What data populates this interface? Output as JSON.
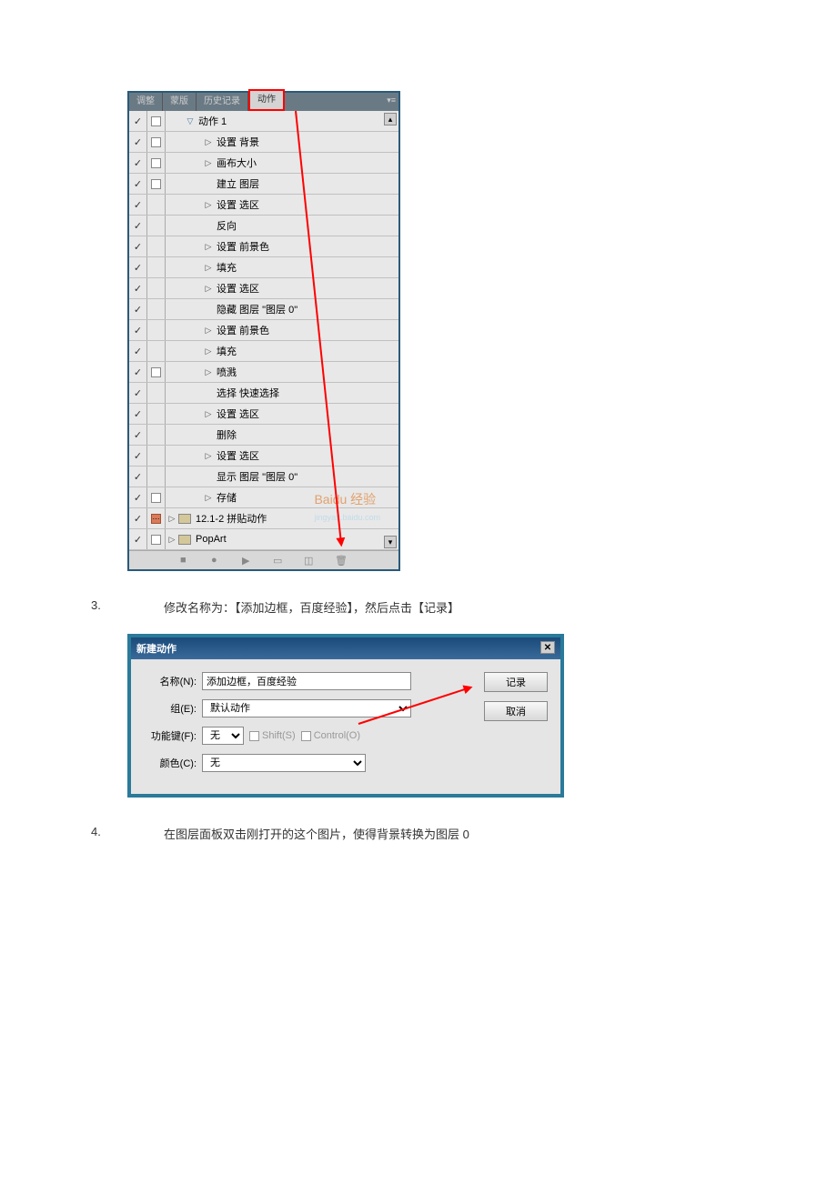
{
  "panel": {
    "tabs": [
      "调整",
      "蒙版",
      "历史记录",
      "动作"
    ],
    "action_set": "动作 1",
    "steps": [
      {
        "expand": "▷",
        "label": "设置 背景",
        "dlg": true
      },
      {
        "expand": "▷",
        "label": "画布大小",
        "dlg": true
      },
      {
        "expand": "",
        "label": "建立 图层",
        "dlg": true
      },
      {
        "expand": "▷",
        "label": "设置 选区"
      },
      {
        "expand": "",
        "label": "反向"
      },
      {
        "expand": "▷",
        "label": "设置 前景色"
      },
      {
        "expand": "▷",
        "label": "填充"
      },
      {
        "expand": "▷",
        "label": "设置 选区"
      },
      {
        "expand": "",
        "label": "隐藏 图层 \"图层 0\""
      },
      {
        "expand": "▷",
        "label": "设置 前景色"
      },
      {
        "expand": "▷",
        "label": "填充"
      },
      {
        "expand": "▷",
        "label": "喷溅",
        "dlg": true
      },
      {
        "expand": "",
        "label": "选择 快速选择"
      },
      {
        "expand": "▷",
        "label": "设置 选区"
      },
      {
        "expand": "",
        "label": "删除"
      },
      {
        "expand": "▷",
        "label": "设置 选区"
      },
      {
        "expand": "",
        "label": "显示 图层 \"图层 0\""
      },
      {
        "expand": "▷",
        "label": "存储",
        "dlg": true
      }
    ],
    "folders": [
      {
        "label": "12.1-2 拼贴动作",
        "red": true
      },
      {
        "label": "PopArt"
      }
    ],
    "watermark_brand": "Baidu 经验",
    "watermark_url": "jingyan.baidu.com"
  },
  "step3": {
    "num": "3.",
    "text": "修改名称为：【添加边框，百度经验】，然后点击【记录】"
  },
  "dialog": {
    "title": "新建动作",
    "name_label": "名称(N):",
    "name_value": "添加边框，百度经验",
    "group_label": "组(E):",
    "group_value": "默认动作",
    "fkey_label": "功能键(F):",
    "fkey_value": "无",
    "shift_label": "Shift(S)",
    "ctrl_label": "Control(O)",
    "color_label": "颜色(C):",
    "color_value": "无",
    "record_btn": "记录",
    "cancel_btn": "取消"
  },
  "step4": {
    "num": "4.",
    "text": "在图层面板双击刚打开的这个图片，使得背景转换为图层 0"
  }
}
